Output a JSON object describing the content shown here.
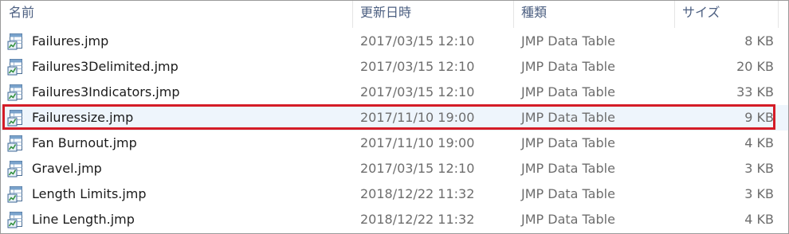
{
  "columns": {
    "name": "名前",
    "date": "更新日時",
    "type": "種類",
    "size": "サイズ"
  },
  "files": [
    {
      "name": "Failures.jmp",
      "date": "2017/03/15 12:10",
      "type": "JMP Data Table",
      "size": "8 KB",
      "icon": "jmp-data-table-icon"
    },
    {
      "name": "Failures3Delimited.jmp",
      "date": "2017/03/15 12:10",
      "type": "JMP Data Table",
      "size": "20 KB",
      "icon": "jmp-data-table-icon"
    },
    {
      "name": "Failures3Indicators.jmp",
      "date": "2017/03/15 12:10",
      "type": "JMP Data Table",
      "size": "33 KB",
      "icon": "jmp-data-table-icon"
    },
    {
      "name": "Failuressize.jmp",
      "date": "2017/11/10 19:00",
      "type": "JMP Data Table",
      "size": "9 KB",
      "icon": "jmp-data-table-icon",
      "highlighted": true
    },
    {
      "name": "Fan Burnout.jmp",
      "date": "2017/11/10 19:00",
      "type": "JMP Data Table",
      "size": "4 KB",
      "icon": "jmp-data-table-icon"
    },
    {
      "name": "Gravel.jmp",
      "date": "2017/03/15 12:10",
      "type": "JMP Data Table",
      "size": "3 KB",
      "icon": "jmp-data-table-icon"
    },
    {
      "name": "Length Limits.jmp",
      "date": "2018/12/22 11:32",
      "type": "JMP Data Table",
      "size": "3 KB",
      "icon": "jmp-data-table-icon"
    },
    {
      "name": "Line Length.jmp",
      "date": "2018/12/22 11:32",
      "type": "JMP Data Table",
      "size": "4 KB",
      "icon": "jmp-data-table-icon"
    }
  ],
  "colors": {
    "highlight_border": "#d41c27",
    "selected_row_bg": "#eef5fc",
    "header_text": "#4d6082"
  }
}
